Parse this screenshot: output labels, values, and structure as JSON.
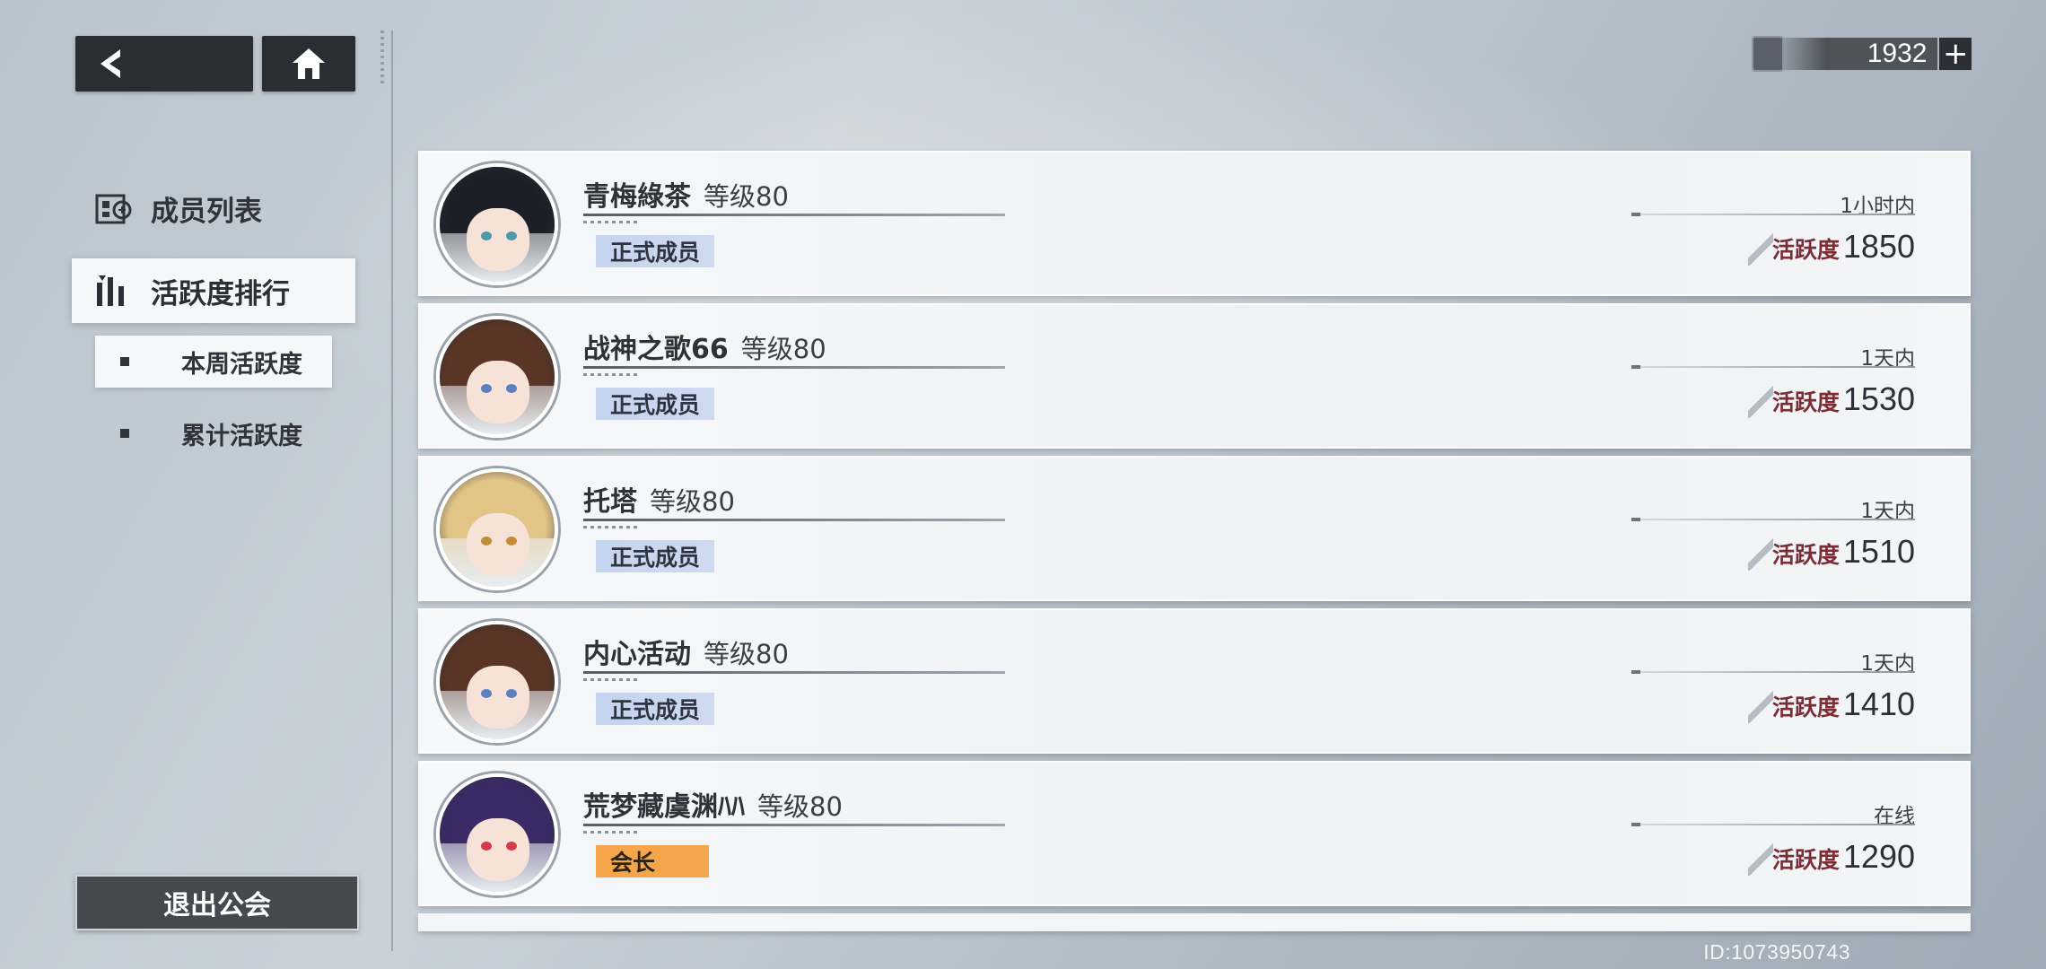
{
  "currency": {
    "amount": "1932",
    "plus": "+"
  },
  "sidebar": {
    "section_title": "成员列表",
    "active_section": "活跃度排行",
    "sub_items": [
      {
        "label": "本周活跃度"
      },
      {
        "label": "累计活跃度"
      }
    ],
    "exit_label": "退出公会"
  },
  "members": [
    {
      "name": "青梅綠茶",
      "level": "等级80",
      "role": "正式成员",
      "last_seen": "1小时内",
      "activity_label": "活跃度",
      "activity": "1850",
      "hair": "#1c1f27",
      "eye": "#4f9aa6"
    },
    {
      "name": "战神之歌66",
      "level": "等级80",
      "role": "正式成员",
      "last_seen": "1天内",
      "activity_label": "活跃度",
      "activity": "1530",
      "hair": "#5a3526",
      "eye": "#5b7fc0"
    },
    {
      "name": "托塔",
      "level": "等级80",
      "role": "正式成员",
      "last_seen": "1天内",
      "activity_label": "活跃度",
      "activity": "1510",
      "hair": "#e2c487",
      "eye": "#c28b3a"
    },
    {
      "name": "内心活动",
      "level": "等级80",
      "role": "正式成员",
      "last_seen": "1天内",
      "activity_label": "活跃度",
      "activity": "1410",
      "hair": "#5a3526",
      "eye": "#5b7fc0"
    },
    {
      "name": "荒梦藏虞渊ﾊﾊ",
      "level": "等级80",
      "role": "会长",
      "last_seen": "在线",
      "activity_label": "活跃度",
      "activity": "1290",
      "hair": "#3b2a66",
      "eye": "#d43a4a"
    }
  ],
  "uid": "ID:1073950743"
}
